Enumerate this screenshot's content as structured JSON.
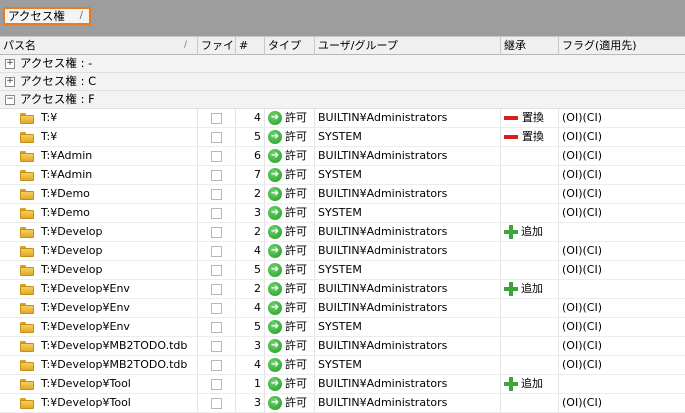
{
  "group_panel": {
    "tag_label": "アクセス権",
    "sort_glyph": "/"
  },
  "columns": [
    {
      "label": "パス名",
      "sort": "/"
    },
    {
      "label": "ファイル",
      "sort": ""
    },
    {
      "label": "#",
      "sort": ""
    },
    {
      "label": "タイプ",
      "sort": ""
    },
    {
      "label": "ユーザ/グループ",
      "sort": ""
    },
    {
      "label": "継承",
      "sort": ""
    },
    {
      "label": "フラグ(適用先)",
      "sort": ""
    }
  ],
  "groups": [
    {
      "expander": "+",
      "label": "アクセス権 : -",
      "rows": []
    },
    {
      "expander": "+",
      "label": "アクセス権 : C",
      "rows": []
    },
    {
      "expander": "−",
      "label": "アクセス権 : F",
      "rows": [
        {
          "path": "T:¥",
          "num": "4",
          "type": "許可",
          "user": "BUILTIN¥Administrators",
          "inherit": "置換",
          "inherit_icon": "minus",
          "flags": "(OI)(CI)"
        },
        {
          "path": "T:¥",
          "num": "5",
          "type": "許可",
          "user": "SYSTEM",
          "inherit": "置換",
          "inherit_icon": "minus",
          "flags": "(OI)(CI)"
        },
        {
          "path": "T:¥Admin",
          "num": "6",
          "type": "許可",
          "user": "BUILTIN¥Administrators",
          "inherit": "",
          "inherit_icon": "",
          "flags": "(OI)(CI)"
        },
        {
          "path": "T:¥Admin",
          "num": "7",
          "type": "許可",
          "user": "SYSTEM",
          "inherit": "",
          "inherit_icon": "",
          "flags": "(OI)(CI)"
        },
        {
          "path": "T:¥Demo",
          "num": "2",
          "type": "許可",
          "user": "BUILTIN¥Administrators",
          "inherit": "",
          "inherit_icon": "",
          "flags": "(OI)(CI)"
        },
        {
          "path": "T:¥Demo",
          "num": "3",
          "type": "許可",
          "user": "SYSTEM",
          "inherit": "",
          "inherit_icon": "",
          "flags": "(OI)(CI)"
        },
        {
          "path": "T:¥Develop",
          "num": "2",
          "type": "許可",
          "user": "BUILTIN¥Administrators",
          "inherit": "追加",
          "inherit_icon": "plus",
          "flags": ""
        },
        {
          "path": "T:¥Develop",
          "num": "4",
          "type": "許可",
          "user": "BUILTIN¥Administrators",
          "inherit": "",
          "inherit_icon": "",
          "flags": "(OI)(CI)"
        },
        {
          "path": "T:¥Develop",
          "num": "5",
          "type": "許可",
          "user": "SYSTEM",
          "inherit": "",
          "inherit_icon": "",
          "flags": "(OI)(CI)"
        },
        {
          "path": "T:¥Develop¥Env",
          "num": "2",
          "type": "許可",
          "user": "BUILTIN¥Administrators",
          "inherit": "追加",
          "inherit_icon": "plus",
          "flags": ""
        },
        {
          "path": "T:¥Develop¥Env",
          "num": "4",
          "type": "許可",
          "user": "BUILTIN¥Administrators",
          "inherit": "",
          "inherit_icon": "",
          "flags": "(OI)(CI)"
        },
        {
          "path": "T:¥Develop¥Env",
          "num": "5",
          "type": "許可",
          "user": "SYSTEM",
          "inherit": "",
          "inherit_icon": "",
          "flags": "(OI)(CI)"
        },
        {
          "path": "T:¥Develop¥MB2TODO.tdb",
          "num": "3",
          "type": "許可",
          "user": "BUILTIN¥Administrators",
          "inherit": "",
          "inherit_icon": "",
          "flags": "(OI)(CI)"
        },
        {
          "path": "T:¥Develop¥MB2TODO.tdb",
          "num": "4",
          "type": "許可",
          "user": "SYSTEM",
          "inherit": "",
          "inherit_icon": "",
          "flags": "(OI)(CI)"
        },
        {
          "path": "T:¥Develop¥Tool",
          "num": "1",
          "type": "許可",
          "user": "BUILTIN¥Administrators",
          "inherit": "追加",
          "inherit_icon": "plus",
          "flags": ""
        },
        {
          "path": "T:¥Develop¥Tool",
          "num": "3",
          "type": "許可",
          "user": "BUILTIN¥Administrators",
          "inherit": "",
          "inherit_icon": "",
          "flags": "(OI)(CI)"
        }
      ]
    }
  ]
}
